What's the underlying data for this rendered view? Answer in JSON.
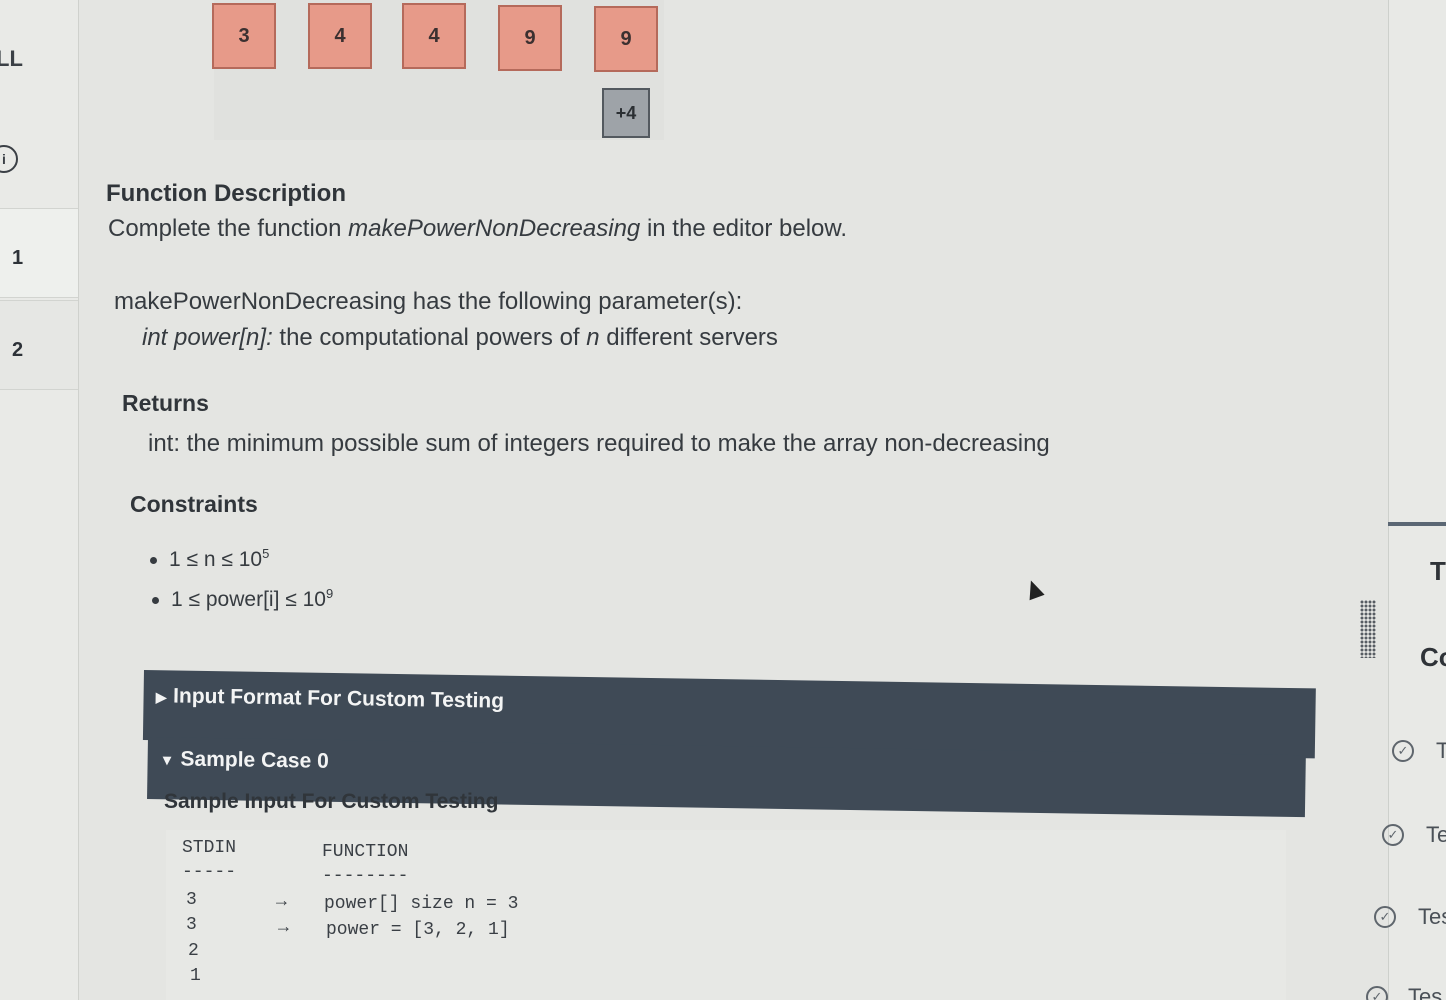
{
  "sidebar": {
    "top_label": "LL",
    "info_icon": "i",
    "items": [
      {
        "label": "1"
      },
      {
        "label": "2"
      }
    ]
  },
  "array": {
    "cells": [
      "3",
      "4",
      "4",
      "9",
      "9"
    ],
    "more": "+4"
  },
  "description": {
    "heading": "Function Description",
    "complete_prefix": "Complete the function ",
    "function_name": "makePowerNonDecreasing",
    "complete_suffix": " in the editor below.",
    "params_intro": "makePowerNonDecreasing has the following parameter(s):",
    "param_name": "int power[n]:",
    "param_desc_prefix": " the computational powers of ",
    "param_n": "n",
    "param_desc_suffix": " different servers",
    "returns_heading": "Returns",
    "returns_text": "int: the minimum possible sum of integers required to make the array non-decreasing",
    "constraints_heading": "Constraints",
    "constraint1_base": "1 ≤ n ≤ 10",
    "constraint1_exp": "5",
    "constraint2_base": "1 ≤ power[i] ≤ 10",
    "constraint2_exp": "9"
  },
  "sections": {
    "input_format": "Input Format For Custom Testing",
    "sample_case": "Sample Case 0",
    "sample_input_heading": "Sample Input For Custom Testing"
  },
  "code": {
    "col1": "STDIN",
    "col2": "FUNCTION",
    "rule1": "-----",
    "rule2": "--------",
    "rows": [
      {
        "stdin": "3",
        "arrow": "→",
        "func": "power[] size n = 3"
      },
      {
        "stdin": "3",
        "arrow": "→",
        "func": "power = [3, 2, 1]"
      },
      {
        "stdin": "2",
        "arrow": "",
        "func": ""
      },
      {
        "stdin": "1",
        "arrow": "",
        "func": ""
      }
    ]
  },
  "right_panel": {
    "t_label": "T",
    "c_label": "Co",
    "tests": [
      "T",
      "Te",
      "Tes",
      "Tes"
    ]
  }
}
